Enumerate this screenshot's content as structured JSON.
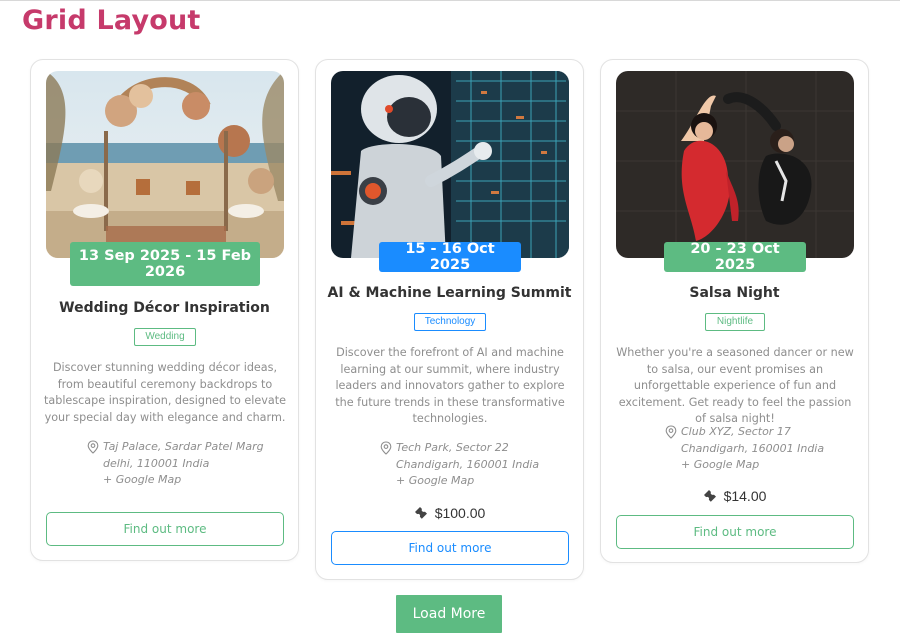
{
  "page": {
    "title": "Grid Layout"
  },
  "colors": {
    "title": "#c63a6b",
    "green": "#5dbb82",
    "blue": "#1a8cff"
  },
  "cards": [
    {
      "date": "13 Sep 2025 - 15 Feb 2026",
      "title": "Wedding Décor Inspiration",
      "tag": "Wedding",
      "description": "Discover stunning wedding décor ideas, from beautiful ceremony backdrops to tablescape inspiration, designed to elevate your special day with elegance and charm.",
      "location": {
        "line1": "Taj Palace, Sardar Patel Marg",
        "line2": "delhi, 110001 India",
        "map": "+ Google Map"
      },
      "price": "",
      "button": "Find out more"
    },
    {
      "date": "15 - 16 Oct 2025",
      "title": "AI & Machine Learning Summit",
      "tag": "Technology",
      "description": "Discover the forefront of AI and machine learning at our summit, where industry leaders and innovators gather to explore the future trends in these transformative technologies.",
      "location": {
        "line1": "Tech Park, Sector 22",
        "line2": "Chandigarh, 160001 India",
        "map": "+ Google Map"
      },
      "price": "$100.00",
      "button": "Find out more"
    },
    {
      "date": "20 - 23 Oct 2025",
      "title": "Salsa Night",
      "tag": "Nightlife",
      "description": "Whether you're a seasoned dancer or new to salsa, our event promises an unforgettable experience of fun and excitement. Get ready to feel the passion of salsa night!",
      "location": {
        "line1": "Club XYZ, Sector 17",
        "line2": "Chandigarh, 160001 India",
        "map": "+ Google Map"
      },
      "price": "$14.00",
      "button": "Find out more"
    }
  ],
  "load_more": "Load More"
}
